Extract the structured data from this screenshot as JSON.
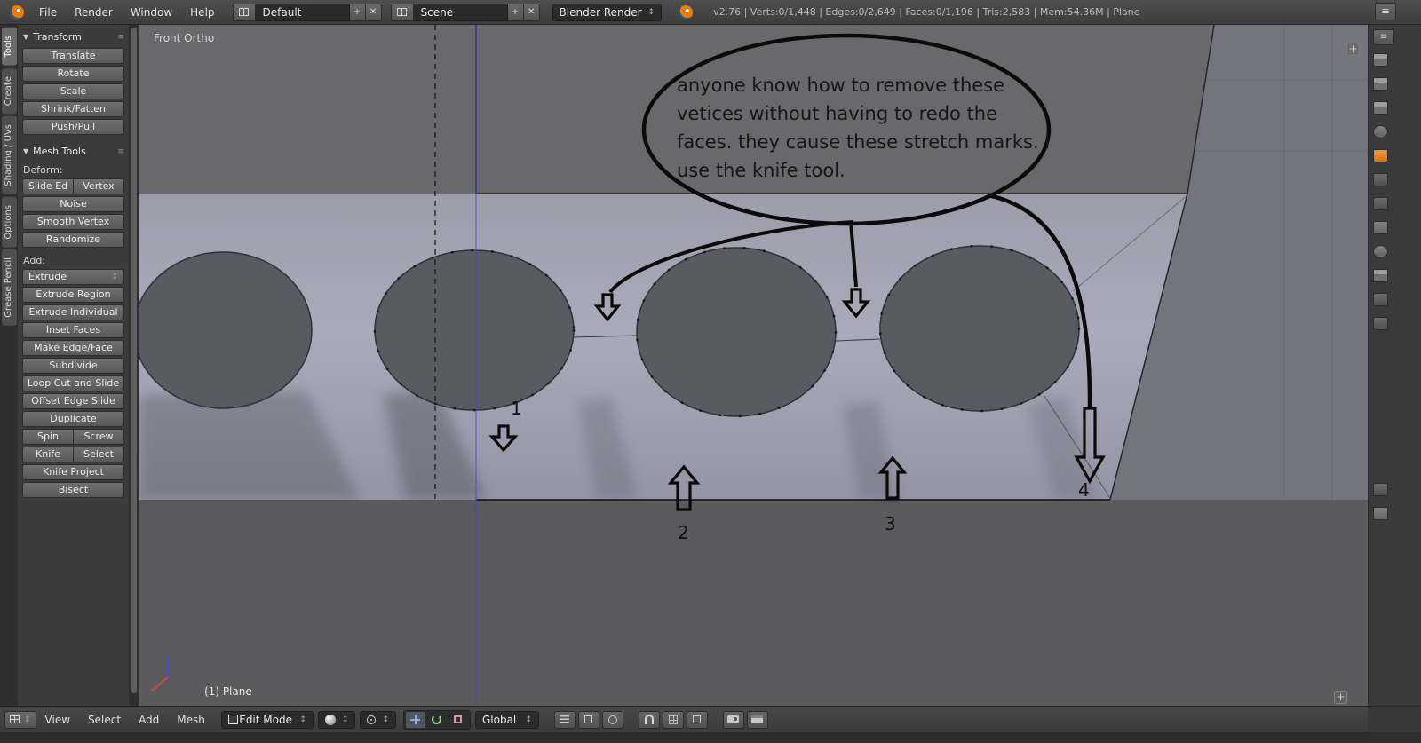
{
  "icons": {
    "panel_arrow": "▼",
    "updown": "↕",
    "plus": "+",
    "close": "✕",
    "grip": "≡"
  },
  "colors": {
    "object_accent": "#e87d0d",
    "axis_x": "#cc4a4a",
    "axis_z": "#4a4ae0",
    "mesh_surface": "#a6a6b5",
    "viewport_background": "#69696c"
  },
  "top_bar": {
    "menus": [
      "File",
      "Render",
      "Window",
      "Help"
    ],
    "layout_name": "Default",
    "scene_name": "Scene",
    "engine": "Blender Render",
    "stats": "v2.76 | Verts:0/1,448 | Edges:0/2,649 | Faces:0/1,196 | Tris:2,583 | Mem:54.36M | Plane"
  },
  "shelf_tabs": [
    "Tools",
    "Create",
    "Shading / UVs",
    "Options",
    "Grease Pencil"
  ],
  "tool_shelf": {
    "transform_title": "Transform",
    "transform_buttons": [
      "Translate",
      "Rotate",
      "Scale",
      "Shrink/Fatten",
      "Push/Pull"
    ],
    "mesh_tools_title": "Mesh Tools",
    "deform_label": "Deform:",
    "slide": "Slide Ed",
    "vertex": "Vertex",
    "deform_buttons": [
      "Noise",
      "Smooth Vertex",
      "Randomize"
    ],
    "add_label": "Add:",
    "extrude": "Extrude",
    "add_buttons": [
      "Extrude Region",
      "Extrude Individual",
      "Inset Faces",
      "Make Edge/Face",
      "Subdivide",
      "Loop Cut and Slide",
      "Offset Edge Slide",
      "Duplicate"
    ],
    "spin": "Spin",
    "screw": "Screw",
    "knife": "Knife",
    "select": "Select",
    "tail_buttons": [
      "Knife Project",
      "Bisect"
    ]
  },
  "viewport": {
    "view_label": "Front Ortho",
    "object_info": "(1) Plane",
    "annotation_lines": [
      "anyone know how to remove these",
      "vetices without having to redo the",
      "faces. they cause these stretch marks. i",
      "use the knife tool."
    ],
    "arrow_labels": [
      "1",
      "2",
      "3",
      "4"
    ]
  },
  "properties_tabs": [
    "render",
    "render-layers",
    "scene",
    "world",
    "object",
    "constraints",
    "modifiers",
    "object-data",
    "material",
    "texture",
    "particles",
    "physics"
  ],
  "bottom_bar": {
    "menus": [
      "View",
      "Select",
      "Add",
      "Mesh"
    ],
    "mode": "Edit Mode",
    "orientation": "Global"
  }
}
